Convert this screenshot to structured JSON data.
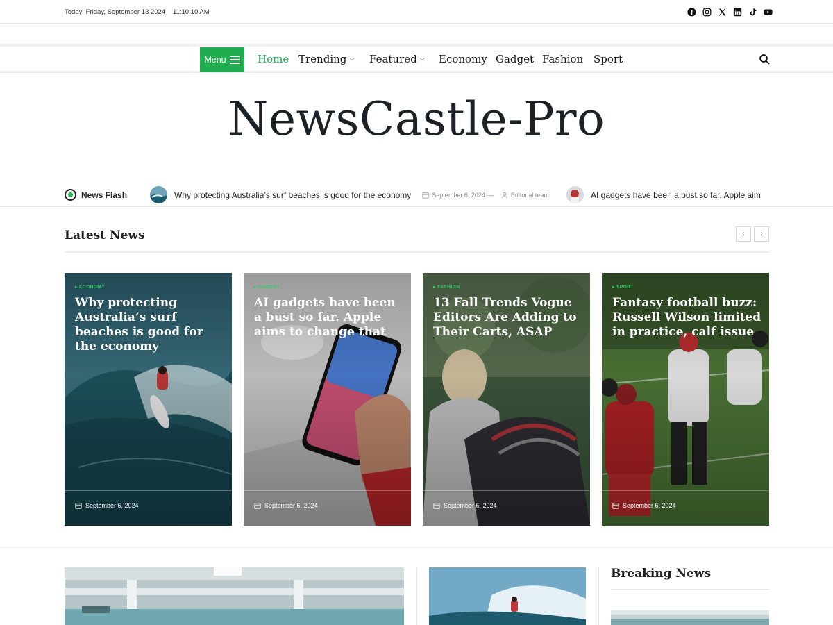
{
  "topbar": {
    "date": "Today: Friday, September 13 2024",
    "time": "11:10:10 AM",
    "socials": [
      "facebook-icon",
      "instagram-icon",
      "x-icon",
      "linkedin-icon",
      "tiktok-icon",
      "youtube-icon"
    ]
  },
  "nav": {
    "menu_label": "Menu",
    "items": [
      {
        "label": "Home",
        "active": true
      },
      {
        "label": "Trending",
        "dropdown": true
      },
      {
        "label": "Featured",
        "dropdown": true
      },
      {
        "label": "Economy"
      },
      {
        "label": "Gadget"
      },
      {
        "label": "Fashion"
      },
      {
        "label": "Sport"
      }
    ]
  },
  "site": {
    "title": "NewsCastle-Pro"
  },
  "news_flash": {
    "label": "News Flash",
    "items": [
      {
        "title": "Why protecting Australia’s surf beaches is good for the economy",
        "date": "September 6, 2024",
        "author": "Editorial team"
      },
      {
        "title": "AI gadgets have been a bust so far. Apple aim"
      }
    ]
  },
  "latest": {
    "heading": "Latest News",
    "cards": [
      {
        "category": "Economy",
        "title": "Why protecting Australia’s surf beaches is good for the economy",
        "date": "September 6, 2024"
      },
      {
        "category": "Gadget",
        "title": "AI gadgets have been a bust so far. Apple aims to change that",
        "date": "September 6, 2024"
      },
      {
        "category": "Fashion",
        "title": "13 Fall Trends Vogue Editors Are Adding to Their Carts, ASAP",
        "date": "September 6, 2024"
      },
      {
        "category": "Sport",
        "title": "Fantasy football buzz: Russell Wilson limited in practice, calf issue",
        "date": "September 6, 2024"
      }
    ]
  },
  "breaking": {
    "heading": "Breaking News"
  },
  "colors": {
    "accent": "#1fad4f",
    "text": "#1f1f1f"
  }
}
